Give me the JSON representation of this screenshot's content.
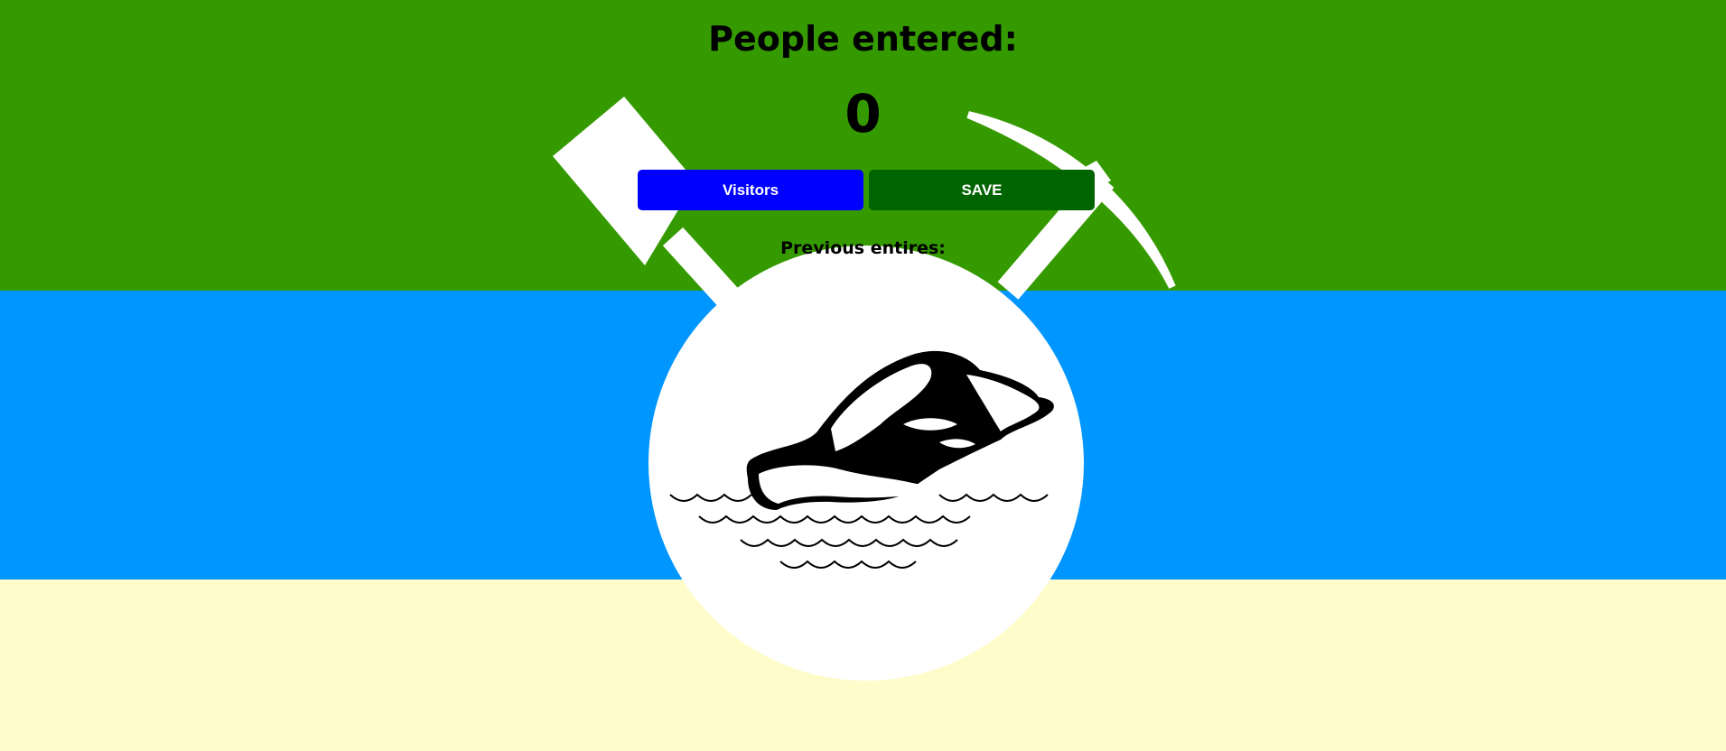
{
  "header": {
    "title": "People entered:",
    "count": "0"
  },
  "buttons": {
    "visitors_label": "Visitors",
    "save_label": "SAVE"
  },
  "previous": {
    "label": "Previous entires:"
  },
  "colors": {
    "stripe_top": "#359a00",
    "stripe_middle": "#0096ff",
    "stripe_bottom": "#fffccc",
    "emblem": "#ffffff",
    "visitors_button": "#0000ff",
    "save_button": "#006400"
  },
  "icons": {
    "emblem": "pick-shovel-hat-emblem-icon"
  }
}
